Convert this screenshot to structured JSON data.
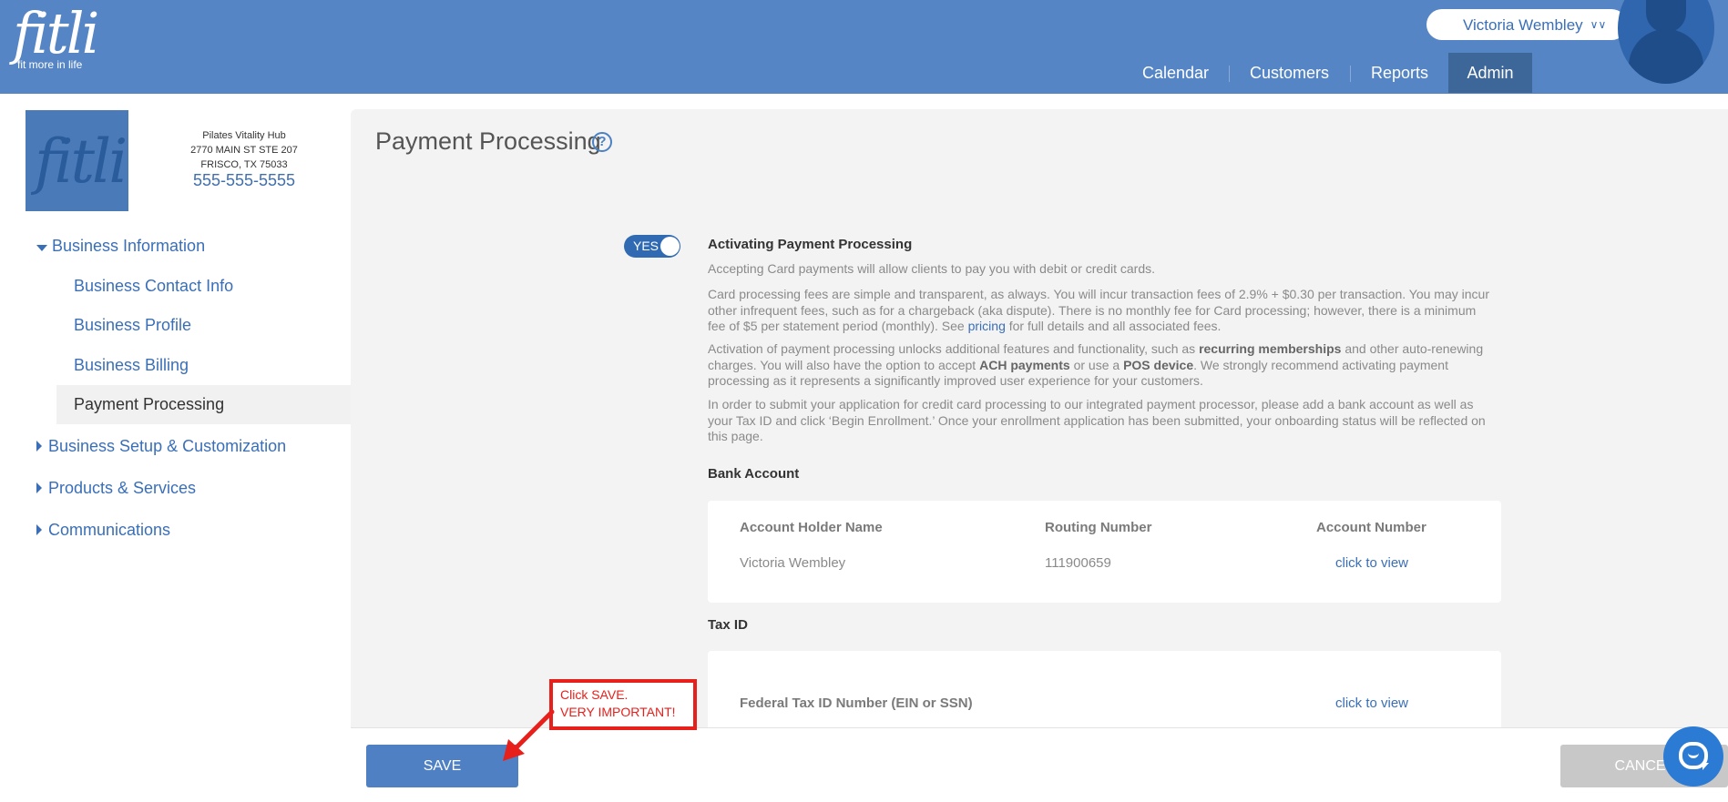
{
  "header": {
    "logo_word": "fitli",
    "logo_tagline": "fit more in life",
    "user_name": "Victoria Wembley",
    "nav": [
      "Calendar",
      "Customers",
      "Reports",
      "Admin"
    ],
    "active_nav": "Admin"
  },
  "business": {
    "logo_word": "fitli",
    "name": "Pilates Vitality Hub",
    "address1": "2770 MAIN ST STE 207",
    "address2": "FRISCO, TX 75033",
    "phone": "555-555-5555"
  },
  "sidebar": {
    "section_open": "Business Information",
    "sub_items": [
      "Business Contact Info",
      "Business Profile",
      "Business Billing",
      "Payment Processing"
    ],
    "active_item": "Payment Processing",
    "sections_closed": [
      "Business Setup & Customization",
      "Products & Services",
      "Communications"
    ]
  },
  "main": {
    "title": "Payment Processing",
    "toggle_label": "YES",
    "activation_heading": "Activating Payment Processing",
    "p1": "Accepting Card payments will allow clients to pay you with debit or credit cards.",
    "p2_before": "Card processing fees are simple and transparent, as always. You will incur transaction fees of 2.9% + $0.30 per transaction. You may incur other infrequent fees, such as for a chargeback (aka dispute). There is no monthly fee for Card processing; however, there is a minimum fee of $5 per statement period (monthly). See ",
    "p2_link": "pricing",
    "p2_after": " for full details and all associated fees.",
    "p3_a": "Activation of payment processing unlocks additional features and functionality, such as ",
    "p3_b": "recurring memberships",
    "p3_c": " and other auto-renewing charges. You will also have the option to accept ",
    "p3_d": "ACH payments",
    "p3_e": " or use a ",
    "p3_f": "POS device",
    "p3_g": ". We strongly recommend activating payment processing as it represents a significantly improved user experience for your customers.",
    "p4": "In order to submit your application for credit card processing to our integrated payment processor, please add a bank account as well as your Tax ID and click ‘Begin Enrollment.’ Once your enrollment application has been submitted, your onboarding status will be reflected on this page.",
    "bank_heading": "Bank Account",
    "bank_columns": [
      "Account Holder Name",
      "Routing Number",
      "Account Number"
    ],
    "bank_row": {
      "holder": "Victoria Wembley",
      "routing": "111900659",
      "account_link": "click to view"
    },
    "tax_heading": "Tax ID",
    "tax_label": "Federal Tax ID Number (EIN or SSN)",
    "tax_link": "click to view"
  },
  "footer": {
    "save_label": "SAVE",
    "cancel_label": "CANCEL"
  },
  "annotation": {
    "line1": "Click SAVE.",
    "line2": "VERY IMPORTANT!"
  },
  "colors": {
    "header": "#5585c4",
    "accent": "#3a6fb7",
    "callout": "#e8201b"
  }
}
